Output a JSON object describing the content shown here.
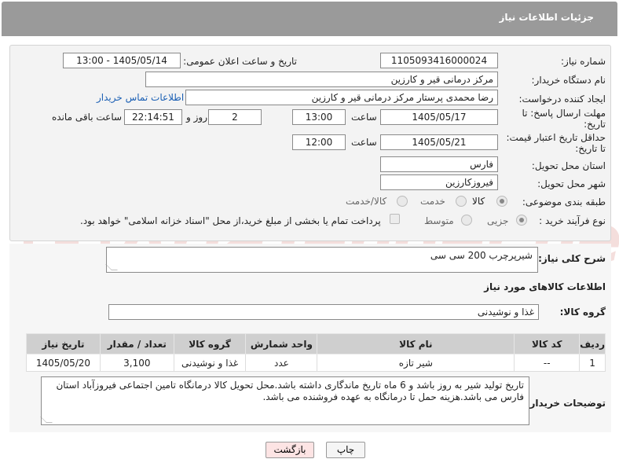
{
  "header": {
    "title": "جزئیات اطلاعات نیاز"
  },
  "fields": {
    "need_number_label": "شماره نیاز:",
    "need_number": "1105093416000024",
    "announce_label": "تاریخ و ساعت اعلان عمومی:",
    "announce_value": "1405/05/14 - 13:00",
    "buyer_org_label": "نام دستگاه خریدار:",
    "buyer_org": "مرکز درمانی قیر و کارزین",
    "creator_label": "ایجاد کننده درخواست:",
    "creator": "رضا محمدی پرستار مرکز درمانی قیر و کارزین",
    "contact_link": "اطلاعات تماس خریدار",
    "deadline_label_1": "مهلت ارسال پاسخ: تا",
    "deadline_label_2": "تاریخ:",
    "deadline_date": "1405/05/17",
    "time_label": "ساعت",
    "deadline_time": "13:00",
    "days_value": "2",
    "days_label": "روز و",
    "remaining_time": "22:14:51",
    "remaining_label": "ساعت باقی مانده",
    "validity_label_1": "حداقل تاریخ اعتبار قیمت:",
    "validity_label_2": "تا تاریخ:",
    "validity_date": "1405/05/21",
    "validity_time": "12:00",
    "province_label": "استان محل تحویل:",
    "province": "فارس",
    "city_label": "شهر محل تحویل:",
    "city": "فیروزکارزین",
    "category_label": "طبقه بندی موضوعی:",
    "category_options": [
      "کالا",
      "خدمت",
      "کالا/خدمت"
    ],
    "process_label": "نوع فرآیند خرید :",
    "process_options": [
      "جزیی",
      "متوسط"
    ],
    "payment_note": "پرداخت تمام یا بخشی از مبلغ خرید،از محل \"اسناد خزانه اسلامی\" خواهد بود."
  },
  "summary": {
    "label": "شرح کلی نیاز:",
    "value": "شیرپرچرب 200 سی سی"
  },
  "goods": {
    "section_title": "اطلاعات کالاهای مورد نیاز",
    "group_label": "گروه کالا:",
    "group_value": "غذا و نوشیدنی",
    "columns": [
      "ردیف",
      "کد کالا",
      "نام کالا",
      "واحد شمارش",
      "گروه کالا",
      "تعداد / مقدار",
      "تاریخ نیاز"
    ],
    "rows": [
      [
        "1",
        "--",
        "شیر تازه",
        "عدد",
        "غذا و نوشیدنی",
        "3,100",
        "1405/05/20"
      ]
    ]
  },
  "buyer_notes": {
    "label": "توضیحات خریدار:",
    "value": "تاریخ تولید شیر به روز باشد و 6 ماه تاریخ ماندگاری داشته باشد.محل تحویل کالا درمانگاه تامین اجتماعی فیروزآباد استان فارس می باشد.هزینه حمل تا درمانگاه به عهده فروشنده می باشد."
  },
  "buttons": {
    "print": "چاپ",
    "back": "بازگشت"
  },
  "watermark": "AriaTender.net",
  "colors": {
    "header_bg": "#9a9a9a",
    "link": "#1a5fb4",
    "back_button_bg": "#fde4e4"
  }
}
